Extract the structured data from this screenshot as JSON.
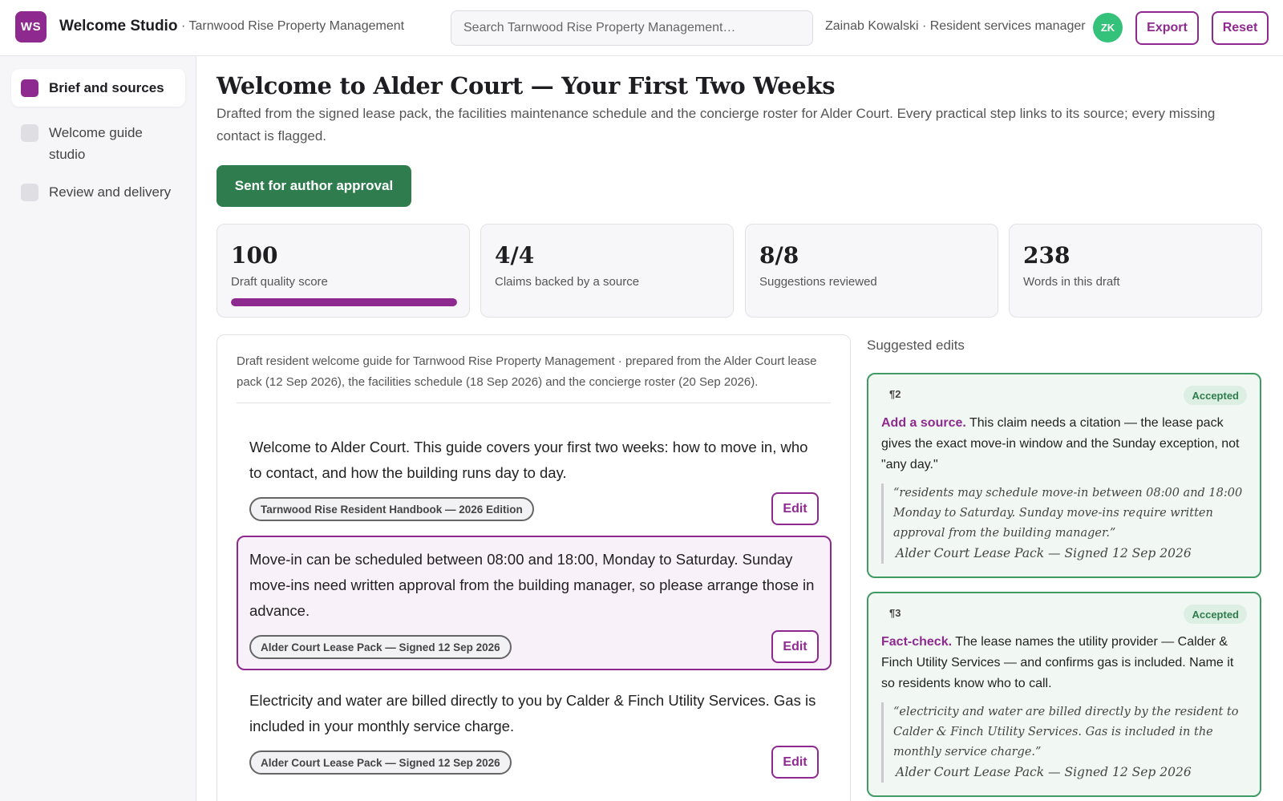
{
  "app": {
    "logo_initials": "WS",
    "title": "Welcome Studio",
    "org": "· Tarnwood Rise Property Management",
    "search_placeholder": "Search Tarnwood Rise Property Management…",
    "user": "Zainab Kowalski · Resident services manager",
    "avatar_initials": "ZK",
    "export_label": "Export",
    "reset_label": "Reset"
  },
  "sidebar": {
    "items": [
      {
        "label": "Brief and sources",
        "active": true
      },
      {
        "label": "Welcome guide studio",
        "active": false
      },
      {
        "label": "Review and delivery",
        "active": false
      }
    ]
  },
  "main": {
    "title": "Welcome to Alder Court — Your First Two Weeks",
    "subtitle": "Drafted from the signed lease pack, the facilities maintenance schedule and the concierge roster for Alder Court. Every practical step links to its source; every missing contact is flagged.",
    "status_label": "Sent for author approval"
  },
  "stats": [
    {
      "value": "100",
      "label": "Draft quality score",
      "progress": 1.0
    },
    {
      "value": "4/4",
      "label": "Claims backed by a source"
    },
    {
      "value": "8/8",
      "label": "Suggestions reviewed"
    },
    {
      "value": "238",
      "label": "Words in this draft"
    }
  ],
  "draft": {
    "note": "Draft resident welcome guide for Tarnwood Rise Property Management · prepared from the Alder Court lease pack (12 Sep 2026), the facilities schedule (18 Sep 2026) and the concierge roster (20 Sep 2026).",
    "edit_label": "Edit",
    "paragraphs": [
      {
        "text": "Welcome to Alder Court. This guide covers your first two weeks: how to move in, who to contact, and how the building runs day to day.",
        "source": "Tarnwood Rise Resident Handbook — 2026 Edition"
      },
      {
        "text": "Move-in can be scheduled between 08:00 and 18:00, Monday to Saturday. Sunday move-ins need written approval from the building manager, so please arrange those in advance.",
        "source": "Alder Court Lease Pack — Signed 12 Sep 2026"
      },
      {
        "text": "Electricity and water are billed directly to you by Calder & Finch Utility Services. Gas is included in your monthly service charge.",
        "source": "Alder Court Lease Pack — Signed 12 Sep 2026"
      }
    ]
  },
  "suggestions": {
    "heading": "Suggested edits",
    "items": [
      {
        "para": "¶2",
        "status": "Accepted",
        "kind": "Add a source.",
        "body": "This claim needs a citation — the lease pack gives the exact move-in window and the Sunday exception, not \"any day.\"",
        "quote": "“residents may schedule move-in between 08:00 and 18:00 Monday to Saturday. Sunday move-ins require written approval from the building manager.”",
        "source": "Alder Court Lease Pack — Signed 12 Sep 2026"
      },
      {
        "para": "¶3",
        "status": "Accepted",
        "kind": "Fact-check.",
        "body": "The lease names the utility provider — Calder & Finch Utility Services — and confirms gas is included. Name it so residents know who to call.",
        "quote": "“electricity and water are billed directly by the resident to Calder & Finch Utility Services. Gas is included in the monthly service charge.”",
        "source": "Alder Court Lease Pack — Signed 12 Sep 2026"
      }
    ]
  },
  "colors": {
    "accent": "#8e2a8f",
    "success": "#2f7d4e",
    "avatar": "#34c27a"
  }
}
